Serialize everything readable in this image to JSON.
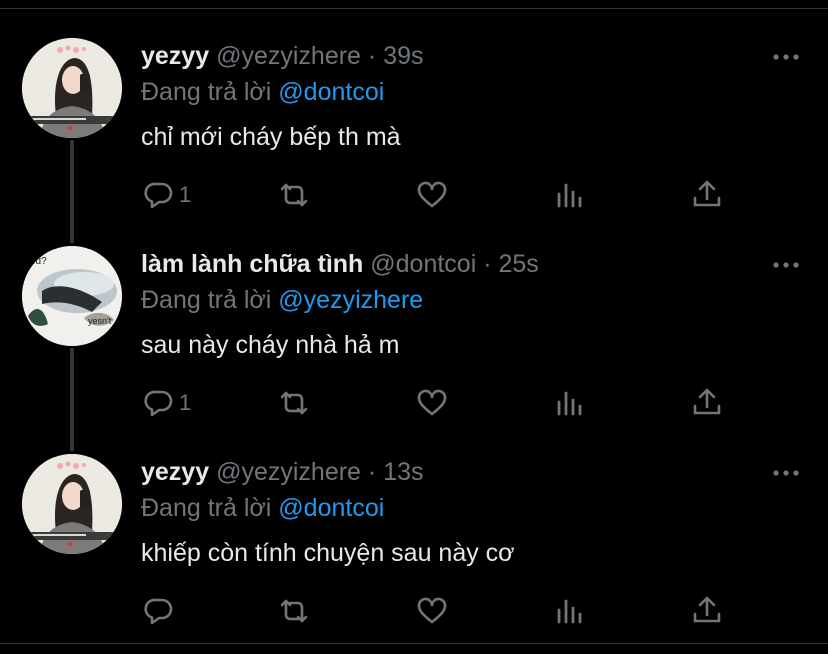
{
  "tweets": [
    {
      "name": "yezyy",
      "handle": "@yezyizhere",
      "time": "39s",
      "reply_prefix": "Đang trả lời",
      "reply_to": "@dontcoi",
      "text": "chỉ mới cháy bếp th mà",
      "reply_count": "1",
      "avatar_icon": "profile-photo-girl"
    },
    {
      "name": "làm lành chữa tình",
      "handle": "@dontcoi",
      "time": "25s",
      "reply_prefix": "Đang trả lời",
      "reply_to": "@yezyizhere",
      "text": "sau này cháy nhà hả m",
      "reply_count": "1",
      "avatar_icon": "profile-photo-cat-meme",
      "avatar_text_top": "od?",
      "avatar_text_bottom": "yesn't"
    },
    {
      "name": "yezyy",
      "handle": "@yezyizhere",
      "time": "13s",
      "reply_prefix": "Đang trả lời",
      "reply_to": "@dontcoi",
      "text": "khiếp còn tính chuyện sau này cơ",
      "reply_count": "",
      "avatar_icon": "profile-photo-girl"
    }
  ],
  "separator": "·",
  "colors": {
    "background": "#000000",
    "text": "#e7e9ea",
    "muted": "#71767b",
    "link": "#1d9bf0"
  }
}
